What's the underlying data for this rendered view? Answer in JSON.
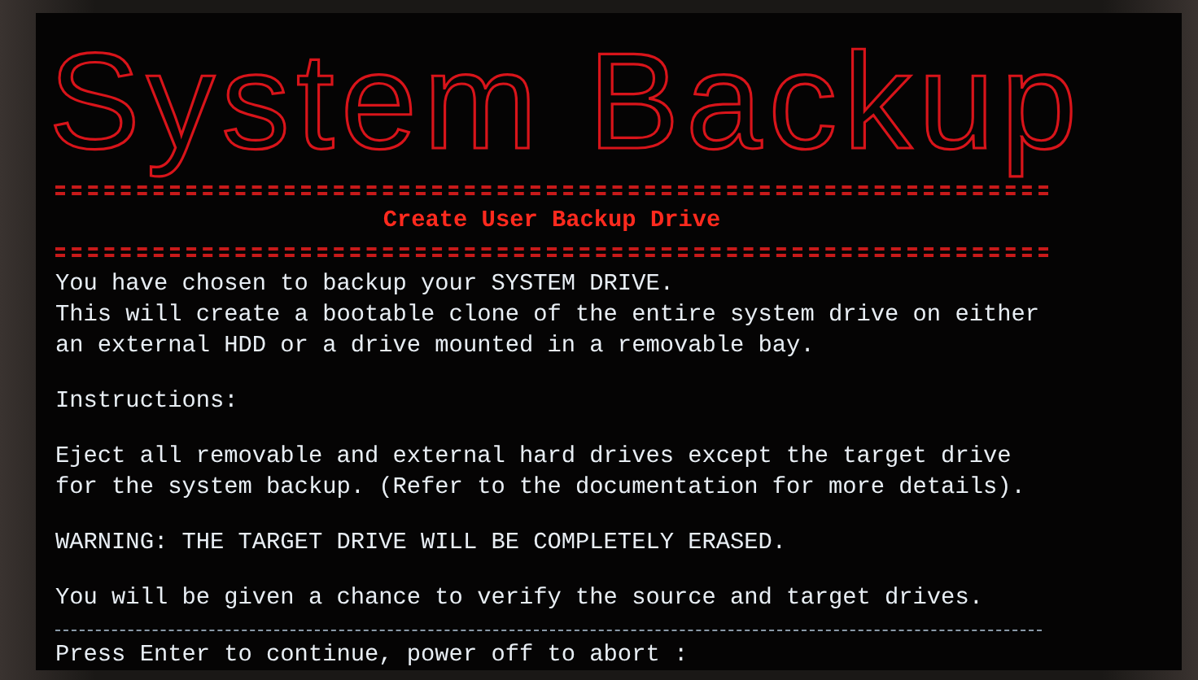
{
  "banner": "System Backup",
  "heading": "Create User Backup Drive",
  "paragraphs": [
    {
      "kind": "text",
      "lines": [
        "You have chosen to backup your SYSTEM DRIVE.",
        "This will create a bootable clone of the entire system drive on either",
        "an external HDD or a drive mounted in a removable bay."
      ]
    },
    {
      "kind": "text",
      "lines": [
        "Instructions:"
      ]
    },
    {
      "kind": "text",
      "lines": [
        "Eject all removable and external hard drives except the target drive",
        "for the system backup. (Refer to the documentation for more details)."
      ]
    },
    {
      "kind": "text",
      "lines": [
        "WARNING: THE TARGET DRIVE WILL BE COMPLETELY ERASED."
      ]
    },
    {
      "kind": "text",
      "lines": [
        "You will be given a chance to verify the source and target drives."
      ]
    }
  ],
  "prompt": "Press Enter to continue, power off to abort :"
}
